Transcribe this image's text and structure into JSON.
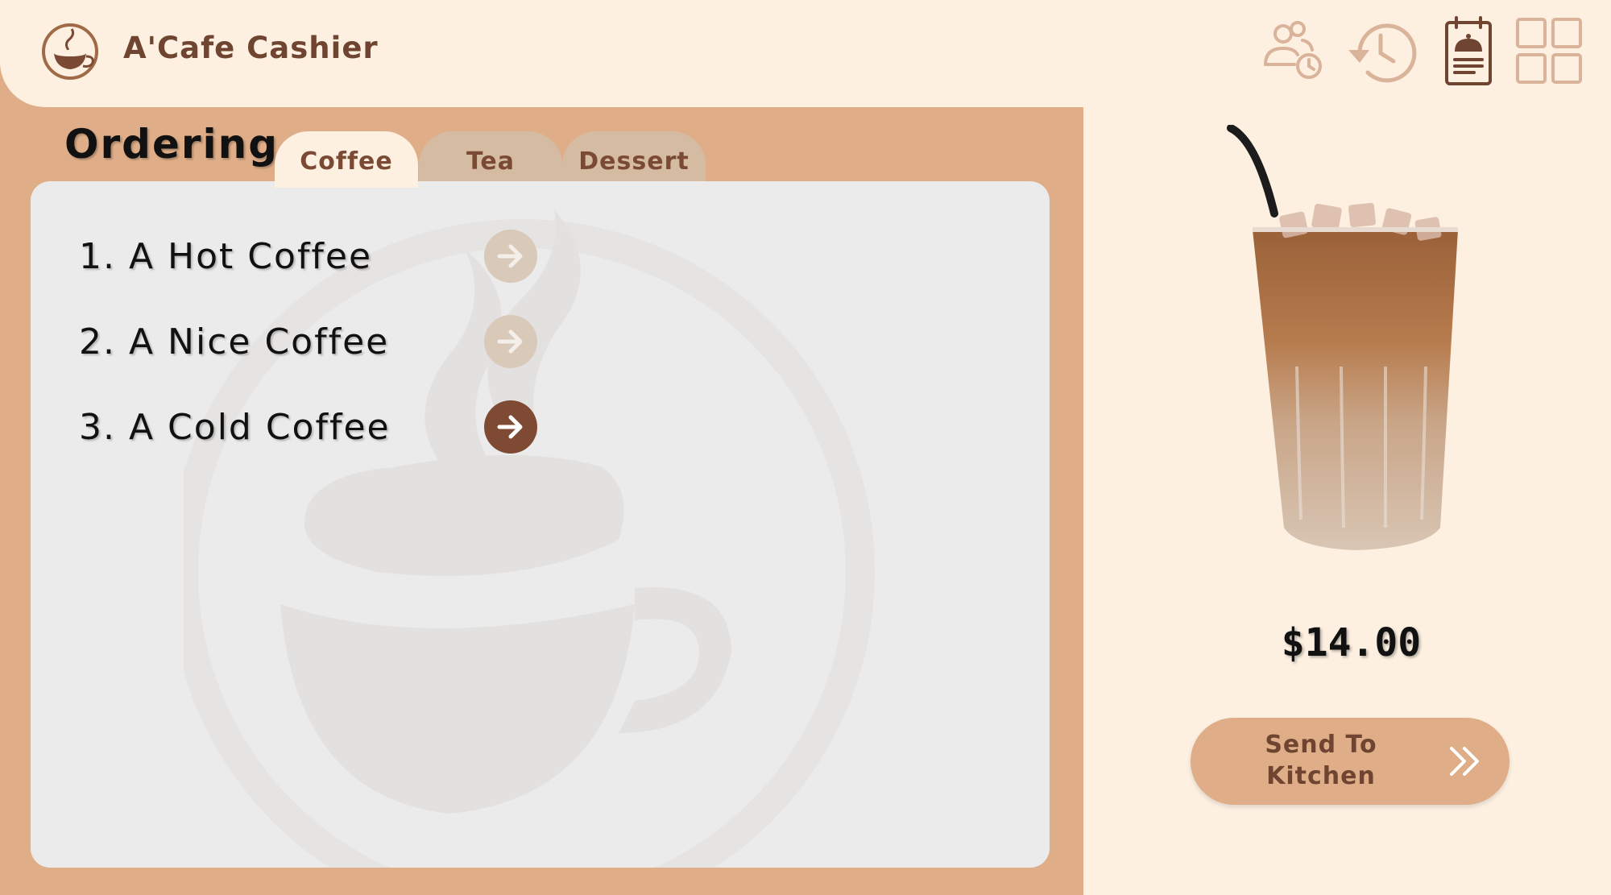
{
  "app": {
    "title": "A'Cafe Cashier",
    "logo_icon": "coffee-cup-logo-icon"
  },
  "header": {
    "icons": [
      {
        "name": "customer-history-icon"
      },
      {
        "name": "history-icon"
      },
      {
        "name": "kitchen-orders-icon"
      },
      {
        "name": "dashboard-grid-icon"
      }
    ]
  },
  "ordering": {
    "title": "Ordering",
    "tabs": [
      {
        "label": "Coffee",
        "active": true
      },
      {
        "label": "Tea",
        "active": false
      },
      {
        "label": "Dessert",
        "active": false
      }
    ],
    "items": [
      {
        "label": "1.  A Hot Coffee",
        "selected": false
      },
      {
        "label": "2.  A Nice Coffee",
        "selected": false
      },
      {
        "label": "3.  A Cold Coffee",
        "selected": true
      }
    ]
  },
  "product": {
    "image": "iced-coffee-glass",
    "price": "$14.00"
  },
  "actions": {
    "send_label_line1": "Send To",
    "send_label_line2": "Kitchen"
  },
  "colors": {
    "cream": "#fdf0e1",
    "tan": "#dfae88",
    "brown": "#7e4a33",
    "panel": "#ebebeb"
  }
}
